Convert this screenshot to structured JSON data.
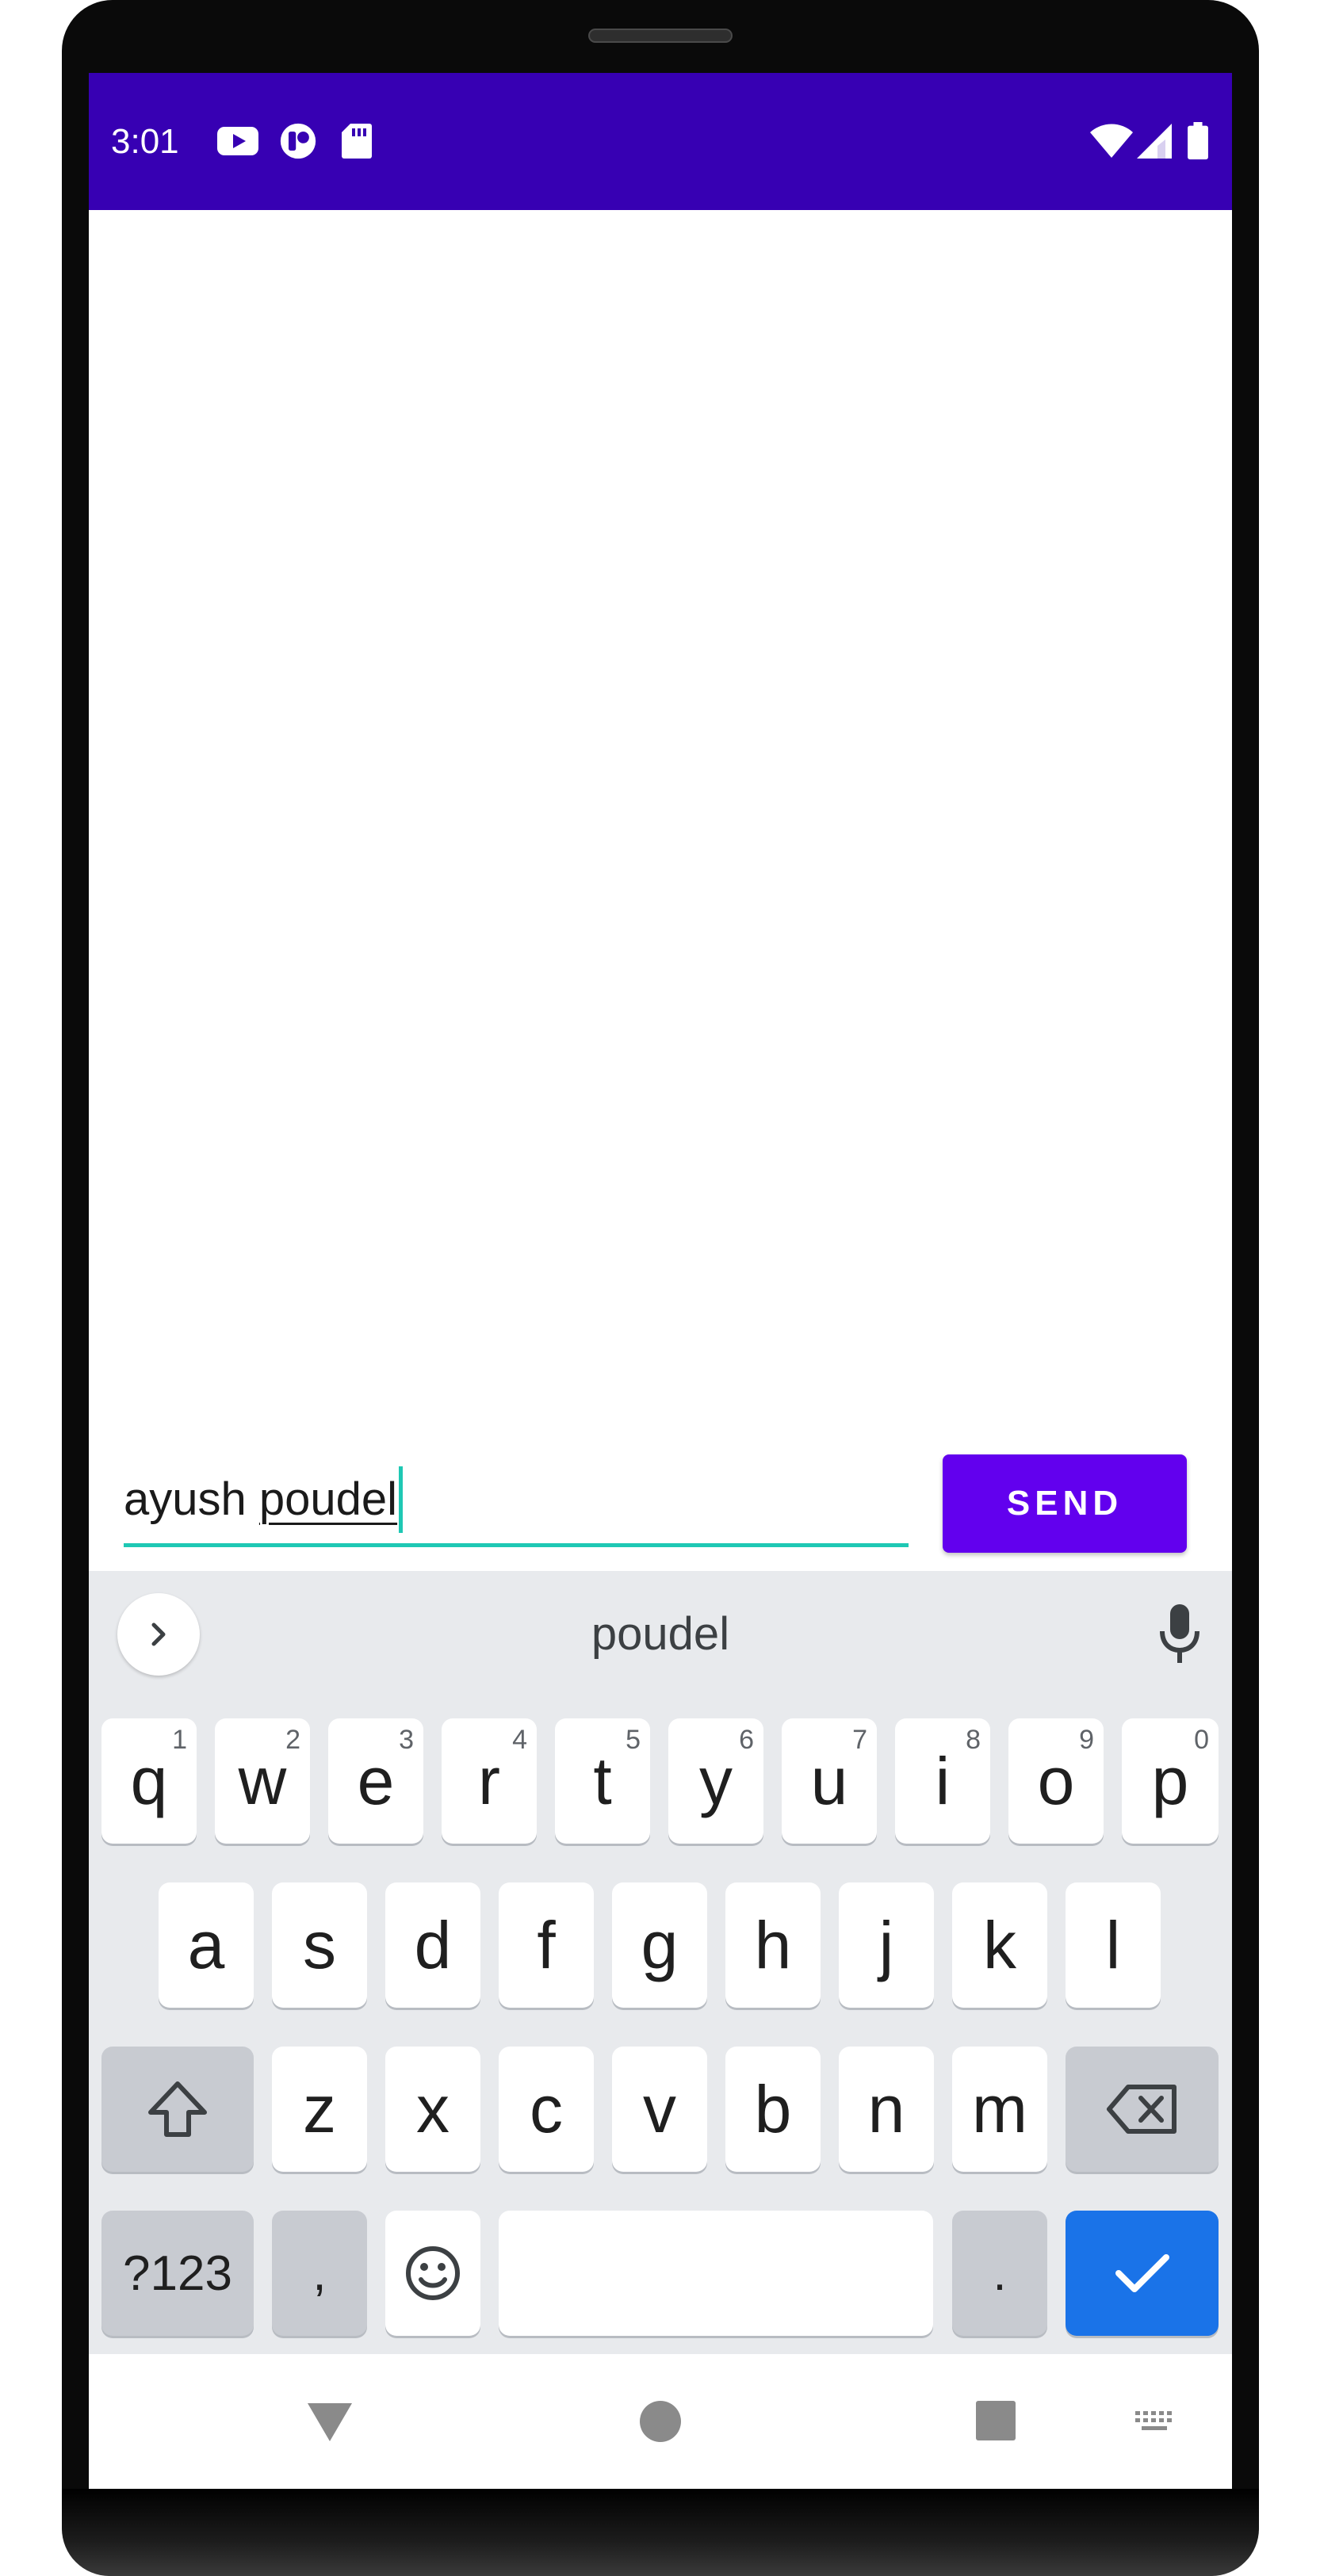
{
  "status_bar": {
    "time": "3:01",
    "background": "#3700b3",
    "icons": [
      "youtube-icon",
      "app-notification-icon",
      "sd-card-icon",
      "wifi-icon",
      "cell-signal-icon",
      "battery-icon"
    ]
  },
  "compose": {
    "input_value_prefix": "ayush ",
    "input_value_composing": "poudel",
    "send_label": "SEND",
    "accent": "#6200ee",
    "underline_color": "#1ec8b4"
  },
  "keyboard": {
    "suggestion": "poudel",
    "row1": [
      {
        "label": "q",
        "hint": "1"
      },
      {
        "label": "w",
        "hint": "2"
      },
      {
        "label": "e",
        "hint": "3"
      },
      {
        "label": "r",
        "hint": "4"
      },
      {
        "label": "t",
        "hint": "5"
      },
      {
        "label": "y",
        "hint": "6"
      },
      {
        "label": "u",
        "hint": "7"
      },
      {
        "label": "i",
        "hint": "8"
      },
      {
        "label": "o",
        "hint": "9"
      },
      {
        "label": "p",
        "hint": "0"
      }
    ],
    "row2": [
      "a",
      "s",
      "d",
      "f",
      "g",
      "h",
      "j",
      "k",
      "l"
    ],
    "row3": [
      "z",
      "x",
      "c",
      "v",
      "b",
      "n",
      "m"
    ],
    "symbols_label": "?123",
    "comma_label": ",",
    "period_label": ".",
    "enter_color": "#1a73e8"
  },
  "nav_bar": {
    "icons": [
      "back-icon",
      "home-icon",
      "recents-icon",
      "keyboard-switch-icon"
    ]
  }
}
